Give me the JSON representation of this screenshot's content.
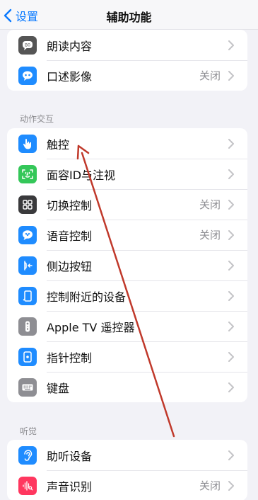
{
  "nav": {
    "back_label": "设置",
    "title": "辅助功能"
  },
  "group_top": [
    {
      "label": "朗读内容",
      "value": "",
      "icon": "speech-bubble-icon",
      "color": "#555555"
    },
    {
      "label": "口述影像",
      "value": "关闭",
      "icon": "quote-bubble-icon",
      "color": "#1f8cff"
    }
  ],
  "section_interaction": {
    "header": "动作交互",
    "items": [
      {
        "label": "触控",
        "value": "",
        "icon": "hand-touch-icon",
        "color": "#1f8cff"
      },
      {
        "label": "面容ID与注视",
        "value": "",
        "icon": "face-id-icon",
        "color": "#34c759"
      },
      {
        "label": "切换控制",
        "value": "关闭",
        "icon": "grid-icon",
        "color": "#3a3a3c"
      },
      {
        "label": "语音控制",
        "value": "关闭",
        "icon": "voice-control-icon",
        "color": "#1f8cff"
      },
      {
        "label": "侧边按钮",
        "value": "",
        "icon": "side-button-icon",
        "color": "#1f8cff"
      },
      {
        "label": "控制附近的设备",
        "value": "",
        "icon": "nearby-device-icon",
        "color": "#1f8cff"
      },
      {
        "label": "Apple TV 遥控器",
        "value": "",
        "icon": "tv-remote-icon",
        "color": "#8e8e93"
      },
      {
        "label": "指针控制",
        "value": "",
        "icon": "pointer-icon",
        "color": "#1f8cff"
      },
      {
        "label": "键盘",
        "value": "",
        "icon": "keyboard-icon",
        "color": "#8e8e93"
      }
    ]
  },
  "section_hearing": {
    "header": "听觉",
    "items": [
      {
        "label": "助听设备",
        "value": "",
        "icon": "ear-icon",
        "color": "#1f8cff"
      },
      {
        "label": "声音识别",
        "value": "关闭",
        "icon": "sound-wave-icon",
        "color": "#ff375f"
      }
    ]
  },
  "annotation": {
    "color": "#c0392b"
  }
}
